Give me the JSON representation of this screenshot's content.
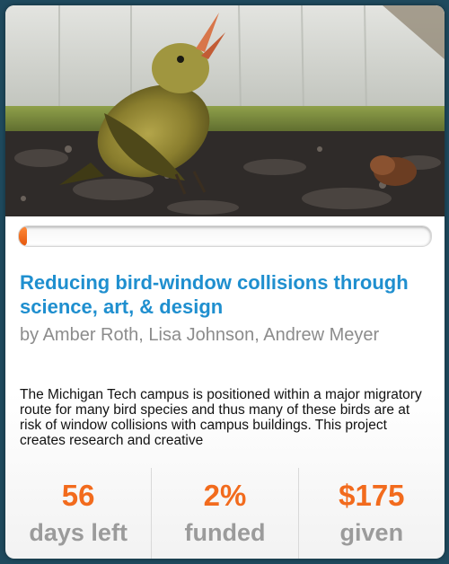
{
  "project": {
    "title": "Reducing bird-window collisions through science, art, & design",
    "authors": "by Amber Roth, Lisa Johnson, Andrew Meyer",
    "description": "The Michigan Tech campus is positioned within a major migratory route for many bird species and thus many of these birds are at risk of window collisions with campus buildings. This project creates research and creative",
    "progress_percent": 2
  },
  "stats": {
    "days": {
      "value": "56",
      "label": "days left"
    },
    "funded": {
      "value": "2%",
      "label": "funded"
    },
    "given": {
      "value": "$175",
      "label": "given"
    }
  },
  "colors": {
    "title": "#1f8fcf",
    "accent": "#f26b1d",
    "muted": "#9b9b9b"
  }
}
